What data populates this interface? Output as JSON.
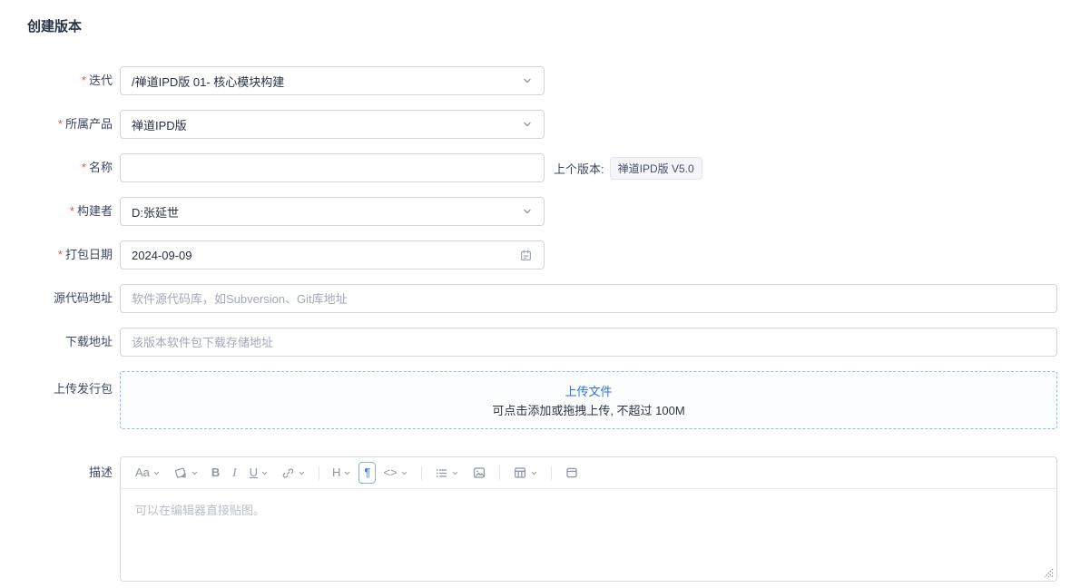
{
  "page": {
    "title": "创建版本",
    "required_mark": "*"
  },
  "fields": {
    "iteration": {
      "label": "迭代",
      "value": "/禅道IPD版 01- 核心模块构建"
    },
    "product": {
      "label": "所属产品",
      "value": "禅道IPD版"
    },
    "name": {
      "label": "名称",
      "value": "",
      "prev_version_label": "上个版本:",
      "prev_version_value": "禅道IPD版 V5.0"
    },
    "builder": {
      "label": "构建者",
      "value": "D:张延世"
    },
    "build_date": {
      "label": "打包日期",
      "value": "2024-09-09"
    },
    "source_code": {
      "label": "源代码地址",
      "placeholder": "软件源代码库，如Subversion、Git库地址"
    },
    "download": {
      "label": "下载地址",
      "placeholder": "该版本软件包下载存储地址"
    },
    "upload": {
      "label": "上传发行包",
      "link_text": "上传文件",
      "hint": "可点击添加或拖拽上传, 不超过 100M"
    },
    "description": {
      "label": "描述",
      "placeholder": "可以在编辑器直接贴图。"
    }
  },
  "editor_toolbar": {
    "font_glyph": "Aa",
    "bold_glyph": "B",
    "italic_glyph": "I",
    "underline_glyph": "U",
    "heading_glyph": "H",
    "paragraph_glyph": "¶",
    "code_glyph": "<>"
  },
  "colors": {
    "accent_blue": "#2f6fe4",
    "required_red": "#e5534b",
    "upload_border_blue": "#8fb9f5"
  }
}
